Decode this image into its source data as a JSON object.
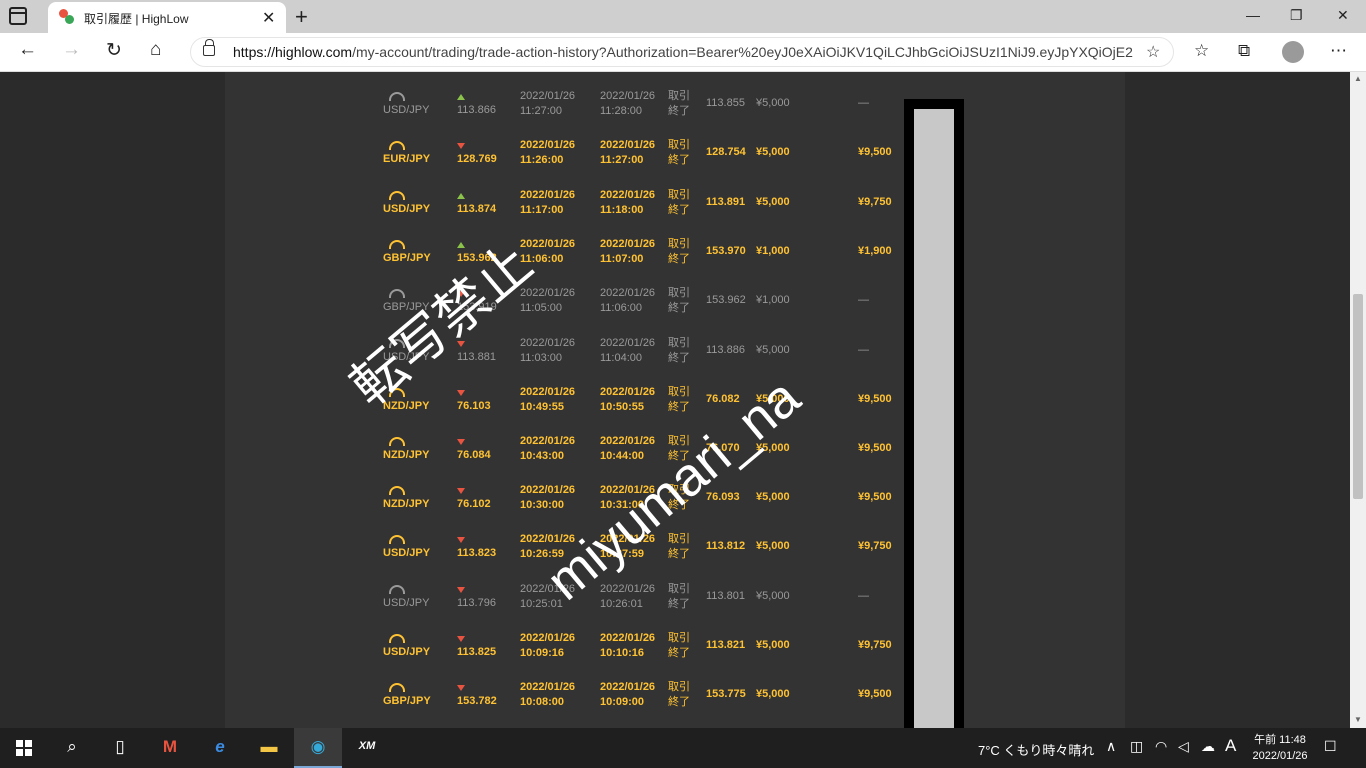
{
  "browser": {
    "tab_title": "取引履歴 | HighLow",
    "url_host": "https://highlow.com",
    "url_path": "/my-account/trading/trade-action-history?Authorization=Bearer%20eyJ0eXAiOiJKV1QiLCJhbGciOiJSUzI1NiJ9.eyJpYXQiOjE2..."
  },
  "colors": {
    "gold": "#ffc233",
    "grey": "#9a9a9a",
    "high_arrow": "#8bc34a",
    "low_arrow": "#e8543f",
    "page_bg": "#2b2b2b",
    "panel_bg": "#333333"
  },
  "trades": [
    {
      "pair": "USD/JPY",
      "direction": "high",
      "strike": "113.866",
      "start_date": "2022/01/26",
      "start_time": "11:27:00",
      "end_date": "2022/01/26",
      "end_time": "11:28:00",
      "status_1": "取引",
      "status_2": "終了",
      "expiry_rate": "113.855",
      "investment": "¥5,000",
      "payout": "—",
      "result": "lose"
    },
    {
      "pair": "EUR/JPY",
      "direction": "low",
      "strike": "128.769",
      "start_date": "2022/01/26",
      "start_time": "11:26:00",
      "end_date": "2022/01/26",
      "end_time": "11:27:00",
      "status_1": "取引",
      "status_2": "終了",
      "expiry_rate": "128.754",
      "investment": "¥5,000",
      "payout": "¥9,500",
      "result": "win"
    },
    {
      "pair": "USD/JPY",
      "direction": "high",
      "strike": "113.874",
      "start_date": "2022/01/26",
      "start_time": "11:17:00",
      "end_date": "2022/01/26",
      "end_time": "11:18:00",
      "status_1": "取引",
      "status_2": "終了",
      "expiry_rate": "113.891",
      "investment": "¥5,000",
      "payout": "¥9,750",
      "result": "win"
    },
    {
      "pair": "GBP/JPY",
      "direction": "high",
      "strike": "153.962",
      "start_date": "2022/01/26",
      "start_time": "11:06:00",
      "end_date": "2022/01/26",
      "end_time": "11:07:00",
      "status_1": "取引",
      "status_2": "終了",
      "expiry_rate": "153.970",
      "investment": "¥1,000",
      "payout": "¥1,900",
      "result": "win"
    },
    {
      "pair": "GBP/JPY",
      "direction": "low",
      "strike": "153.919",
      "start_date": "2022/01/26",
      "start_time": "11:05:00",
      "end_date": "2022/01/26",
      "end_time": "11:06:00",
      "status_1": "取引",
      "status_2": "終了",
      "expiry_rate": "153.962",
      "investment": "¥1,000",
      "payout": "—",
      "result": "lose"
    },
    {
      "pair": "USD/JPY",
      "direction": "low",
      "strike": "113.881",
      "start_date": "2022/01/26",
      "start_time": "11:03:00",
      "end_date": "2022/01/26",
      "end_time": "11:04:00",
      "status_1": "取引",
      "status_2": "終了",
      "expiry_rate": "113.886",
      "investment": "¥5,000",
      "payout": "—",
      "result": "lose"
    },
    {
      "pair": "NZD/JPY",
      "direction": "low",
      "strike": "76.103",
      "start_date": "2022/01/26",
      "start_time": "10:49:55",
      "end_date": "2022/01/26",
      "end_time": "10:50:55",
      "status_1": "取引",
      "status_2": "終了",
      "expiry_rate": "76.082",
      "investment": "¥5,000",
      "payout": "¥9,500",
      "result": "win"
    },
    {
      "pair": "NZD/JPY",
      "direction": "low",
      "strike": "76.084",
      "start_date": "2022/01/26",
      "start_time": "10:43:00",
      "end_date": "2022/01/26",
      "end_time": "10:44:00",
      "status_1": "取引",
      "status_2": "終了",
      "expiry_rate": "76.070",
      "investment": "¥5,000",
      "payout": "¥9,500",
      "result": "win"
    },
    {
      "pair": "NZD/JPY",
      "direction": "low",
      "strike": "76.102",
      "start_date": "2022/01/26",
      "start_time": "10:30:00",
      "end_date": "2022/01/26",
      "end_time": "10:31:00",
      "status_1": "取引",
      "status_2": "終了",
      "expiry_rate": "76.093",
      "investment": "¥5,000",
      "payout": "¥9,500",
      "result": "win"
    },
    {
      "pair": "USD/JPY",
      "direction": "low",
      "strike": "113.823",
      "start_date": "2022/01/26",
      "start_time": "10:26:59",
      "end_date": "2022/01/26",
      "end_time": "10:27:59",
      "status_1": "取引",
      "status_2": "終了",
      "expiry_rate": "113.812",
      "investment": "¥5,000",
      "payout": "¥9,750",
      "result": "win"
    },
    {
      "pair": "USD/JPY",
      "direction": "low",
      "strike": "113.796",
      "start_date": "2022/01/26",
      "start_time": "10:25:01",
      "end_date": "2022/01/26",
      "end_time": "10:26:01",
      "status_1": "取引",
      "status_2": "終了",
      "expiry_rate": "113.801",
      "investment": "¥5,000",
      "payout": "—",
      "result": "lose"
    },
    {
      "pair": "USD/JPY",
      "direction": "low",
      "strike": "113.825",
      "start_date": "2022/01/26",
      "start_time": "10:09:16",
      "end_date": "2022/01/26",
      "end_time": "10:10:16",
      "status_1": "取引",
      "status_2": "終了",
      "expiry_rate": "113.821",
      "investment": "¥5,000",
      "payout": "¥9,750",
      "result": "win"
    },
    {
      "pair": "GBP/JPY",
      "direction": "low",
      "strike": "153.782",
      "start_date": "2022/01/26",
      "start_time": "10:08:00",
      "end_date": "2022/01/26",
      "end_time": "10:09:00",
      "status_1": "取引",
      "status_2": "終了",
      "expiry_rate": "153.775",
      "investment": "¥5,000",
      "payout": "¥9,500",
      "result": "win"
    }
  ],
  "watermark": {
    "line1": "転写禁止",
    "line2": "miyumari_na"
  },
  "taskbar": {
    "weather": "7°C くもり時々晴れ",
    "ime": "A",
    "clock_time": "午前 11:48",
    "clock_date": "2022/01/26",
    "xm_label": "XM"
  }
}
